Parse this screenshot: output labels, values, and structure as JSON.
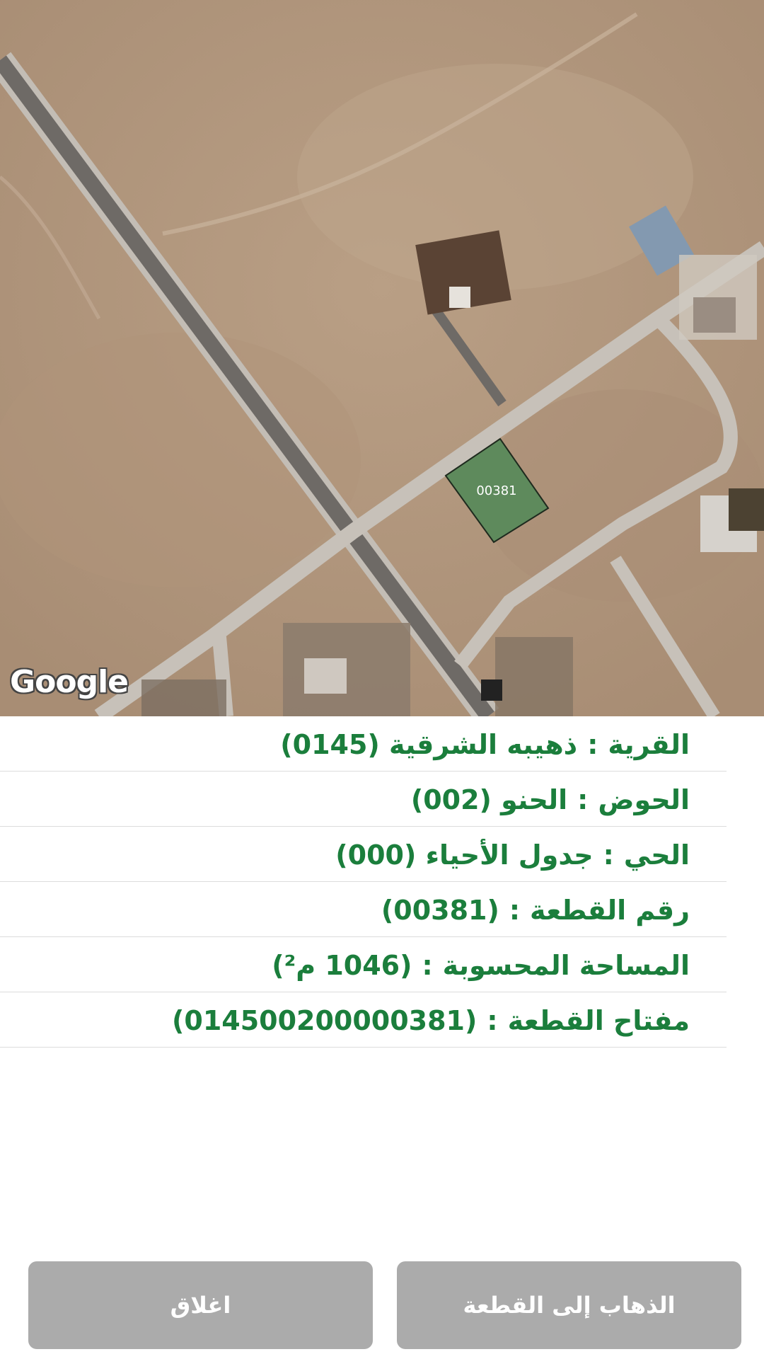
{
  "map": {
    "parcel_label": "00381",
    "attribution": "Google"
  },
  "details": [
    {
      "label": "القرية",
      "value": "ذهيبه الشرقية (0145)"
    },
    {
      "label": "الحوض",
      "value": "الحنو (002)"
    },
    {
      "label": "الحي",
      "value": "جدول الأحياء (000)"
    },
    {
      "label": "رقم القطعة",
      "value": "(00381)"
    },
    {
      "label": "المساحة المحسوبة",
      "value": "(1046 م²)"
    },
    {
      "label": "مفتاح القطعة",
      "value": "(014500200000381)"
    }
  ],
  "buttons": {
    "close": "اغلاق",
    "go_to_parcel": "الذهاب إلى القطعة"
  },
  "colors": {
    "accent": "#1b7e3c",
    "parcel_fill": "#5e8a5c",
    "button_bg": "#ababab"
  }
}
